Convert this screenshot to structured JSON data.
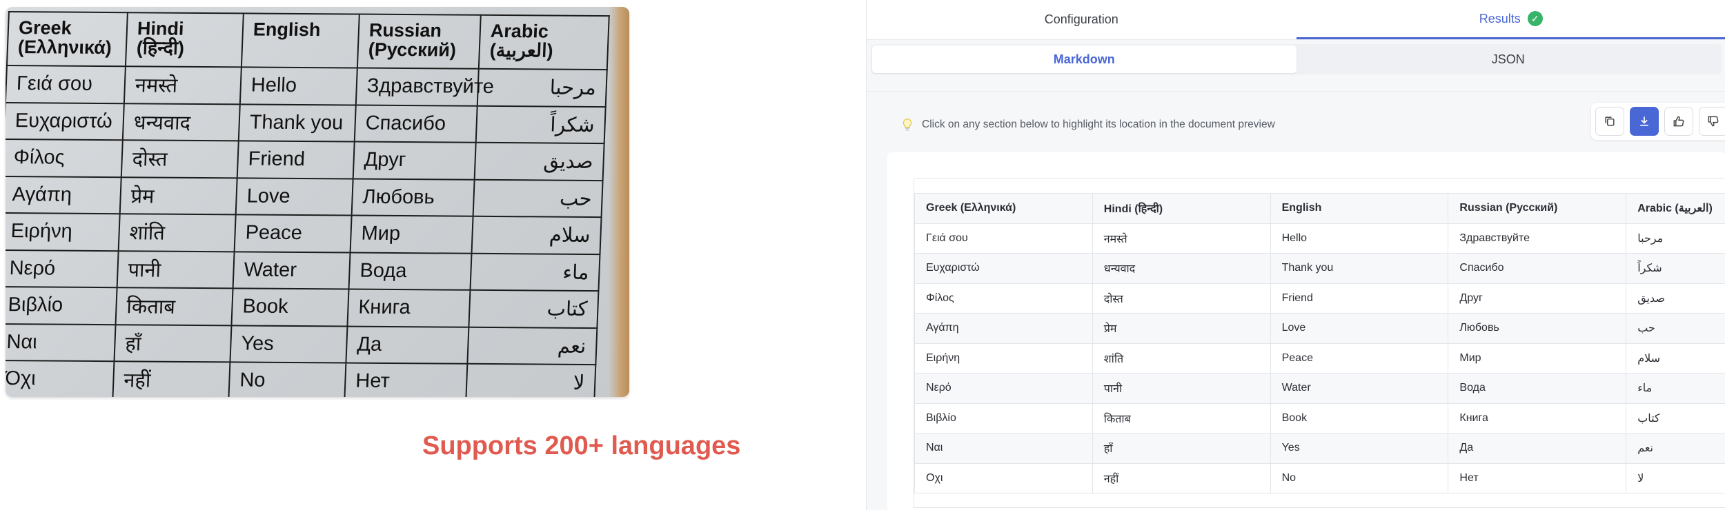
{
  "photo_table": {
    "headers": [
      [
        "Greek",
        "(Ελληνικά)"
      ],
      [
        "Hindi",
        "(हिन्दी)"
      ],
      [
        "English",
        ""
      ],
      [
        "Russian",
        "(Русский)"
      ],
      [
        "Arabic",
        "(العربية)"
      ]
    ],
    "rows": [
      [
        "Γειά σου",
        "नमस्ते",
        "Hello",
        "Здравствуйте",
        "مرحبا"
      ],
      [
        "Ευχαριστώ",
        "धन्यवाद",
        "Thank you",
        "Спасибо",
        "شكراً"
      ],
      [
        "Φίλος",
        "दोस्त",
        "Friend",
        "Друг",
        "صديق"
      ],
      [
        "Αγάπη",
        "प्रेम",
        "Love",
        "Любовь",
        "حب"
      ],
      [
        "Ειρήνη",
        "शांति",
        "Peace",
        "Мир",
        "سلام"
      ],
      [
        "Νερό",
        "पानी",
        "Water",
        "Вода",
        "ماء"
      ],
      [
        "Βιβλίο",
        "किताब",
        "Book",
        "Книга",
        "كتاب"
      ],
      [
        "Ναι",
        "हाँ",
        "Yes",
        "Да",
        "نعم"
      ],
      [
        "Όχι",
        "नहीं",
        "No",
        "Нет",
        "لا"
      ]
    ]
  },
  "tagline": "Supports 200+ languages",
  "panel": {
    "tabs": {
      "configuration": "Configuration",
      "results": "Results"
    },
    "subtabs": {
      "markdown": "Markdown",
      "json": "JSON"
    },
    "hint": "Click on any section below to highlight its location in the document preview",
    "actions": [
      "copy-icon",
      "download-icon",
      "thumbs-up-icon",
      "thumbs-down-icon"
    ],
    "accent_color": "#4a67d6",
    "success_color": "#37b36a"
  },
  "result_table": {
    "headers": [
      "Greek (Ελληνικά)",
      "Hindi (हिन्दी)",
      "English",
      "Russian (Русский)",
      "Arabic (العربية)"
    ],
    "rows": [
      [
        "Γειά σου",
        "नमस्ते",
        "Hello",
        "Здравствуйте",
        "مرحبا"
      ],
      [
        "Ευχαριστώ",
        "धन्यवाद",
        "Thank you",
        "Спасибо",
        "شكراً"
      ],
      [
        "Φίλος",
        "दोस्त",
        "Friend",
        "Друг",
        "صديق"
      ],
      [
        "Αγάπη",
        "प्रेम",
        "Love",
        "Любовь",
        "حب"
      ],
      [
        "Ειρήνη",
        "शांति",
        "Peace",
        "Мир",
        "سلام"
      ],
      [
        "Νερό",
        "पानी",
        "Water",
        "Вода",
        "ماء"
      ],
      [
        "Βιβλίο",
        "किताब",
        "Book",
        "Книга",
        "كتاب"
      ],
      [
        "Ναι",
        "हाँ",
        "Yes",
        "Да",
        "نعم"
      ],
      [
        "Οχι",
        "नहीं",
        "No",
        "Нет",
        "لا"
      ]
    ]
  }
}
